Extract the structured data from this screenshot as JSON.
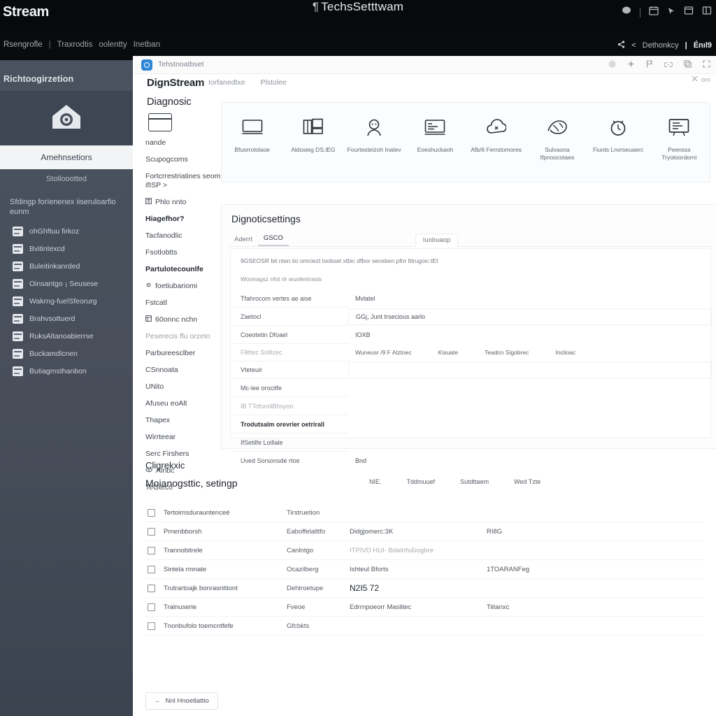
{
  "shell": {
    "brand": "Stream",
    "window_title": "TechsSetttwam",
    "title_marker": "¶",
    "breadcrumb": [
      "Rsengrofle",
      "|",
      "Traxrodtis",
      "oolentty",
      "Inetban"
    ],
    "header_right": {
      "glyph_settings": "settings-glyph",
      "glyph_back": "<",
      "label": "Dethonkcy",
      "separator": "|",
      "value": "Énıl9"
    },
    "topbar_icons": [
      "chat-icon",
      "divider",
      "calendar-icon",
      "cursor-icon",
      "window-icon",
      "grid-icon"
    ]
  },
  "sidebar": {
    "title": "Richtoogirzetion",
    "hero_icon": "home-gear-icon",
    "active_item": "Amehnsetiors",
    "subtitle": "Stolloootted",
    "group_label": "Sfdingp forIenenex\niiseruloarfio eunm",
    "items": [
      {
        "icon": "list-icon",
        "label": "ohGhftuu firkoz"
      },
      {
        "icon": "rows-icon",
        "label": "Bvitintexcd"
      },
      {
        "icon": "table-icon",
        "label": "Buleitinkanrded"
      },
      {
        "icon": "chart-icon",
        "label": "Oinsantgo ¡ Seusese"
      },
      {
        "icon": "grid-icon",
        "label": "Wakrng-fuelSfeorurg"
      },
      {
        "icon": "card-icon",
        "label": "Brahvsottuerd"
      },
      {
        "icon": "doc-icon",
        "label": "RuksAltanoabierrse"
      },
      {
        "icon": "image-icon",
        "label": "Buckamdlcnen"
      },
      {
        "icon": "panel-icon",
        "label": "Butiagmsthanbon"
      }
    ]
  },
  "inner_window": {
    "app_icon": "app-circle-icon",
    "app_name": "Tehstnoatbset",
    "nav_word": "DignStream",
    "nav_links": [
      "Iorfanedtxe",
      "Plstolee"
    ],
    "section_head": "Diagnosic",
    "tool_icons": [
      "brightness-icon",
      "sparkle-icon",
      "flag-icon",
      "link-icon",
      "copy-icon",
      "expand-icon"
    ],
    "tool_icons_2": [
      "close-icon",
      "orn"
    ],
    "left_column": {
      "icon": "window-icon",
      "entries": [
        {
          "text": "nande",
          "style": "normal"
        },
        {
          "text": "Scupogcoms",
          "style": "normal"
        },
        {
          "text": "Fortcrrestriatines seoml ifISP >",
          "style": "normal"
        },
        {
          "text": "Phlo nnto",
          "style": "normal",
          "glyph": "filter-icon"
        },
        {
          "text": "Hiagefhor?",
          "style": "bold"
        },
        {
          "text": "Tacfanodlic",
          "style": "normal"
        },
        {
          "text": "Fsotlobtts",
          "style": "normal"
        },
        {
          "text": "Partulotecounlfe",
          "style": "bold"
        },
        {
          "text": "foetiubariomi",
          "style": "normal",
          "glyph": "gear-icon"
        },
        {
          "text": "Fstcatl",
          "style": "normal"
        },
        {
          "text": "60onnc nchn",
          "style": "normal",
          "glyph": "box-icon"
        },
        {
          "text": "Peserecis ffu orzeto",
          "style": "dim"
        },
        {
          "text": "Parbureesclber",
          "style": "normal"
        },
        {
          "text": "CSnnoata",
          "style": "normal"
        },
        {
          "text": "UNito",
          "style": "normal"
        },
        {
          "text": "Afuseu eoAlt",
          "style": "normal"
        },
        {
          "text": "Thapex",
          "style": "normal"
        },
        {
          "text": "Wirrteear",
          "style": "normal"
        },
        {
          "text": "Serc Firshers",
          "style": "normal"
        },
        {
          "text": "Ainbc",
          "style": "normal",
          "glyph": "eye-icon"
        },
        {
          "text": "TeGteco",
          "style": "normal"
        }
      ]
    },
    "toolbar_cards": [
      {
        "icon": "monitor-icon",
        "label": "Bfuorrololaoe"
      },
      {
        "icon": "book-folder-icon",
        "label": "Aldosieg\nDS.lEG"
      },
      {
        "icon": "person-icon",
        "label": "Fourtesteizoh\nInatev"
      },
      {
        "icon": "monitor-text-icon",
        "label": "Eoeshuckaoh"
      },
      {
        "icon": "cloud-puzzle-icon",
        "label": "Afb/6\nFerrstomores"
      },
      {
        "icon": "scribble-icon",
        "label": "Sulvaona\nIfpnoocotaes"
      },
      {
        "icon": "clock-icon",
        "label": "Fiunts\nLnvrseuaerc"
      },
      {
        "icon": "screen-text-icon",
        "label": "Peensss\nTryotoordorni"
      }
    ]
  },
  "panel": {
    "title": "Dignoticsettings",
    "tabs": [
      {
        "label": "Aderrt",
        "state": "normal"
      },
      {
        "label": "GSCO",
        "state": "active"
      },
      {
        "label": "Iuobuaop",
        "state": "sel"
      }
    ],
    "note1": "9GSEOSR bit nten tio omciezt loobset xtbic dfbor seceben  pfnr Ittrugoic:tEt",
    "note2": "Woonagsz nfot rir wuolentrasis",
    "rows": [
      {
        "label": "Tfahrocom vertes ae aise",
        "value": "Mvlatel",
        "style": "normal"
      },
      {
        "label": "Zaetocl",
        "value": "GGj, Junt trsecious aarlo",
        "style": "boxed"
      },
      {
        "label": "Coeotetin   Dfoael",
        "value": "IOXB",
        "style": "normal"
      },
      {
        "label": "Fllittec Sollizec",
        "value": "",
        "style": "dim"
      },
      {
        "label": "Vteteuir",
        "value": "",
        "style": "normal"
      },
      {
        "label": "Mc-lee orocitfe",
        "value": "",
        "style": "normal"
      },
      {
        "label": "IB TTofuroilBhsyoo",
        "value": "",
        "style": "dim"
      },
      {
        "label": "Trodutsalm orevrier oetrirall",
        "value": "",
        "style": "bold"
      },
      {
        "label": "IfSetilfe Loillale",
        "value": "",
        "style": "normal"
      },
      {
        "label": "Uved Sorsonsde rtoe",
        "value": "Bnd",
        "style": "normal"
      }
    ],
    "column_headers": [
      "Wuneusr /9 F Alztoec",
      "Kisuate",
      "Teadcn Sigobrec",
      "Inclioac"
    ]
  },
  "lower": {
    "heading": "Cligrekxic",
    "subheading": "Moianogsttic, setingp",
    "table_headers": [
      "NIE.",
      "Tddmuuef",
      "Sutdttaem",
      "Wed Tzte"
    ],
    "rows": [
      {
        "name": "Tertoirnsdurauntenceé",
        "type": "Tirstruetion",
        "a": "",
        "b": ""
      },
      {
        "name": "Prnenbborsh",
        "type": "Eaboffelalttfo",
        "a": "Didgjomerc:3K",
        "b": "RI8G"
      },
      {
        "name": "Trannobitrele",
        "type": "Canlntgo",
        "a": "ITPIVD  HUI-   Bdalnfs&iogbre",
        "a_style": "dim",
        "b": ""
      },
      {
        "name": "Sintela rmnate",
        "type": "Ocazilberg",
        "a": "Ishteul Bforts",
        "b": "1TOARANFeg"
      },
      {
        "name": "Trutrartoajk bonrasnttiont",
        "type": "Dehtroetupe",
        "a": "N2I5 72",
        "a_style": "big",
        "b": ""
      },
      {
        "name": "Tralnuserie",
        "type": "Fveoe",
        "a": "Edrrnpoeorr  Maslitec",
        "b": "Tiitanxc"
      },
      {
        "name": "Tnonbufolo toemcntfefe",
        "type": "Gfcbkts",
        "a": "",
        "b": ""
      }
    ],
    "back_button": {
      "arrow": "←",
      "label": "Nnl Hnoetlattio"
    }
  }
}
